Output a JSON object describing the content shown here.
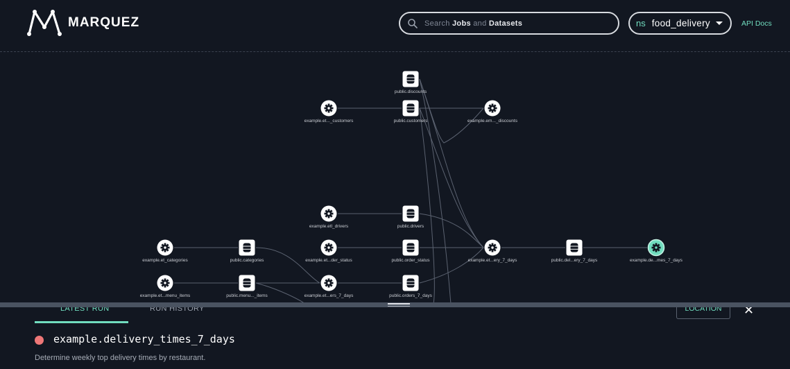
{
  "header": {
    "logo_text": "MARQUEZ",
    "search": {
      "prefix": "Search",
      "jobs": "Jobs",
      "and": "and",
      "datasets": "Datasets"
    },
    "namespace": {
      "prefix": "ns",
      "value": "food_delivery"
    },
    "api_docs": "API Docs"
  },
  "graph": {
    "nodes": [
      {
        "type": "dataset",
        "label": "public.discounts"
      },
      {
        "type": "job",
        "label": "example.et..._customers"
      },
      {
        "type": "dataset",
        "label": "public.customers"
      },
      {
        "type": "job",
        "label": "example.em..._discounts"
      },
      {
        "type": "job",
        "label": "example.etl_drivers"
      },
      {
        "type": "dataset",
        "label": "public.drivers"
      },
      {
        "type": "job",
        "label": "example.et_categories"
      },
      {
        "type": "dataset",
        "label": "public.categories"
      },
      {
        "type": "job",
        "label": "example.et...der_status"
      },
      {
        "type": "dataset",
        "label": "public.order_status"
      },
      {
        "type": "job",
        "label": "example.et...ery_7_days"
      },
      {
        "type": "dataset",
        "label": "public.del...ery_7_days"
      },
      {
        "type": "job",
        "label": "example.de...mes_7_days",
        "selected": true
      },
      {
        "type": "job",
        "label": "example.et...menu_items"
      },
      {
        "type": "dataset",
        "label": "public.menu..._items"
      },
      {
        "type": "job",
        "label": "example.et...ers_7_days"
      },
      {
        "type": "dataset",
        "label": "public.orders_7_days"
      }
    ]
  },
  "drawer": {
    "tabs": [
      "LATEST RUN",
      "RUN HISTORY"
    ],
    "location_button": "LOCATION",
    "job_name": "example.delivery_times_7_days",
    "description": "Determine weekly top delivery times by restaurant."
  },
  "colors": {
    "background": "#121721",
    "accent": "#71ddbf",
    "status_failed": "#ee7777",
    "node_fill": "#ffffff",
    "edge": "#5b6270"
  }
}
